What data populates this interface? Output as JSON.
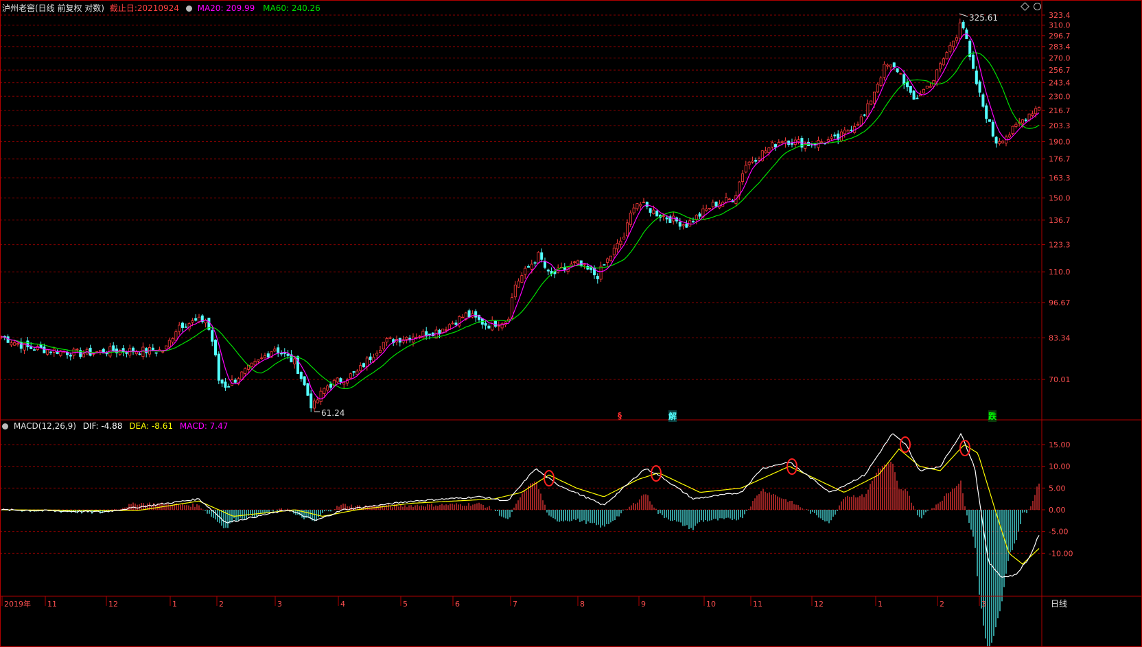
{
  "main_header": {
    "title": "泸州老窖(日线 前复权 对数)",
    "date_label": "截止日:20210924",
    "ma20": "MA20: 209.99",
    "ma60": "MA60: 240.26"
  },
  "macd_header": {
    "name": "MACD(12,26,9)",
    "dif": "DIF: -4.88",
    "dea": "DEA: -8.61",
    "macd": "MACD: 7.47"
  },
  "price_axis": {
    "ticks": [
      "323.4",
      "310.0",
      "296.7",
      "283.4",
      "270.0",
      "256.7",
      "243.4",
      "230.0",
      "216.7",
      "203.3",
      "190.0",
      "176.7",
      "163.3",
      "150.0",
      "136.7",
      "123.3",
      "110.0",
      "96.67",
      "83.34",
      "70.01"
    ]
  },
  "macd_axis": {
    "ticks": [
      "15.00",
      "10.00",
      "5.00",
      "0.00",
      "-5.00",
      "-10.00"
    ]
  },
  "time_axis": {
    "labels": [
      "2019年",
      "11",
      "12",
      "1",
      "2",
      "3",
      "4",
      "5",
      "6",
      "7",
      "8",
      "9",
      "10",
      "11",
      "12",
      "1",
      "2",
      "3"
    ],
    "period_label": "日线"
  },
  "annotations": {
    "high": "325.61",
    "low": "61.24",
    "signal_s": "§",
    "signal_jie": "解",
    "signal_die": "跌"
  },
  "colors": {
    "up": "#ff3b3b",
    "down": "#54ffff",
    "ma20": "#ff00ff",
    "ma60": "#00e000",
    "dif": "#ffffff",
    "dea": "#ffff00",
    "grid": "#8b0000",
    "frame": "#b00000"
  },
  "chart_data": {
    "type": "candlestick",
    "title": "泸州老窖(日线 前复权 对数)",
    "price_range": [
      61.24,
      325.61
    ],
    "price_anchors": [
      {
        "date": "2019-10",
        "close": 84
      },
      {
        "date": "2019-11",
        "close": 80
      },
      {
        "date": "2019-12",
        "close": 81
      },
      {
        "date": "2020-01",
        "close": 88
      },
      {
        "date": "2020-02",
        "close": 72
      },
      {
        "date": "2020-03",
        "close": 62
      },
      {
        "date": "2020-04",
        "close": 72
      },
      {
        "date": "2020-05",
        "close": 84
      },
      {
        "date": "2020-06",
        "close": 90
      },
      {
        "date": "2020-07",
        "close": 118
      },
      {
        "date": "2020-08",
        "close": 112
      },
      {
        "date": "2020-09",
        "close": 150
      },
      {
        "date": "2020-10",
        "close": 150
      },
      {
        "date": "2020-11",
        "close": 195
      },
      {
        "date": "2020-12",
        "close": 195
      },
      {
        "date": "2021-01",
        "close": 270
      },
      {
        "date": "2021-02",
        "close": 320
      },
      {
        "date": "2021-03",
        "close": 200
      },
      {
        "date": "2021-09-24",
        "close": 222
      }
    ],
    "ma20_last": 209.99,
    "ma60_last": 240.26,
    "macd": {
      "params": "12,26,9",
      "dif_last": -4.88,
      "dea_last": -8.61,
      "macd_last": 7.47,
      "ylim": [
        -18,
        18
      ]
    }
  }
}
